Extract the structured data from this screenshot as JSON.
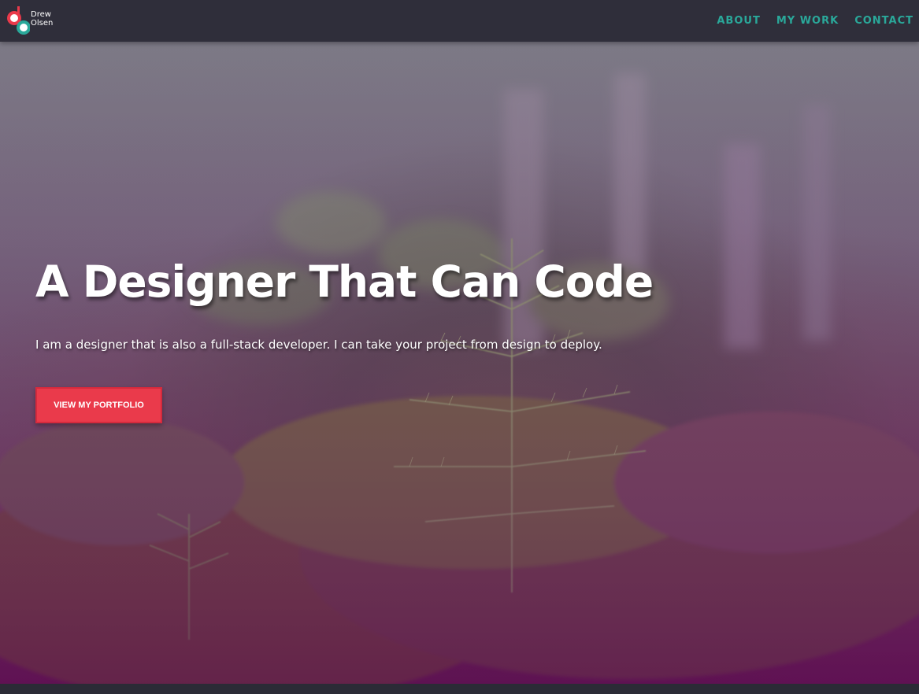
{
  "nav": {
    "logo": {
      "line1": "Drew",
      "line2": "Olsen",
      "colors": {
        "accent_red": "#ea3a4b",
        "accent_teal": "#2aa89a"
      }
    },
    "links": [
      {
        "label": "ABOUT"
      },
      {
        "label": "MY WORK"
      },
      {
        "label": "CONTACT"
      }
    ],
    "link_color": "#2aa89a",
    "background": "#2f2e3a"
  },
  "hero": {
    "title": "A Designer That Can Code",
    "subtitle": "I am a designer that is also a full-stack developer. I can take your project from design to deploy.",
    "cta_label": "VIEW MY PORTFOLIO",
    "cta_color": "#ea3a4b",
    "background_image": "forest-sapling-photo"
  }
}
